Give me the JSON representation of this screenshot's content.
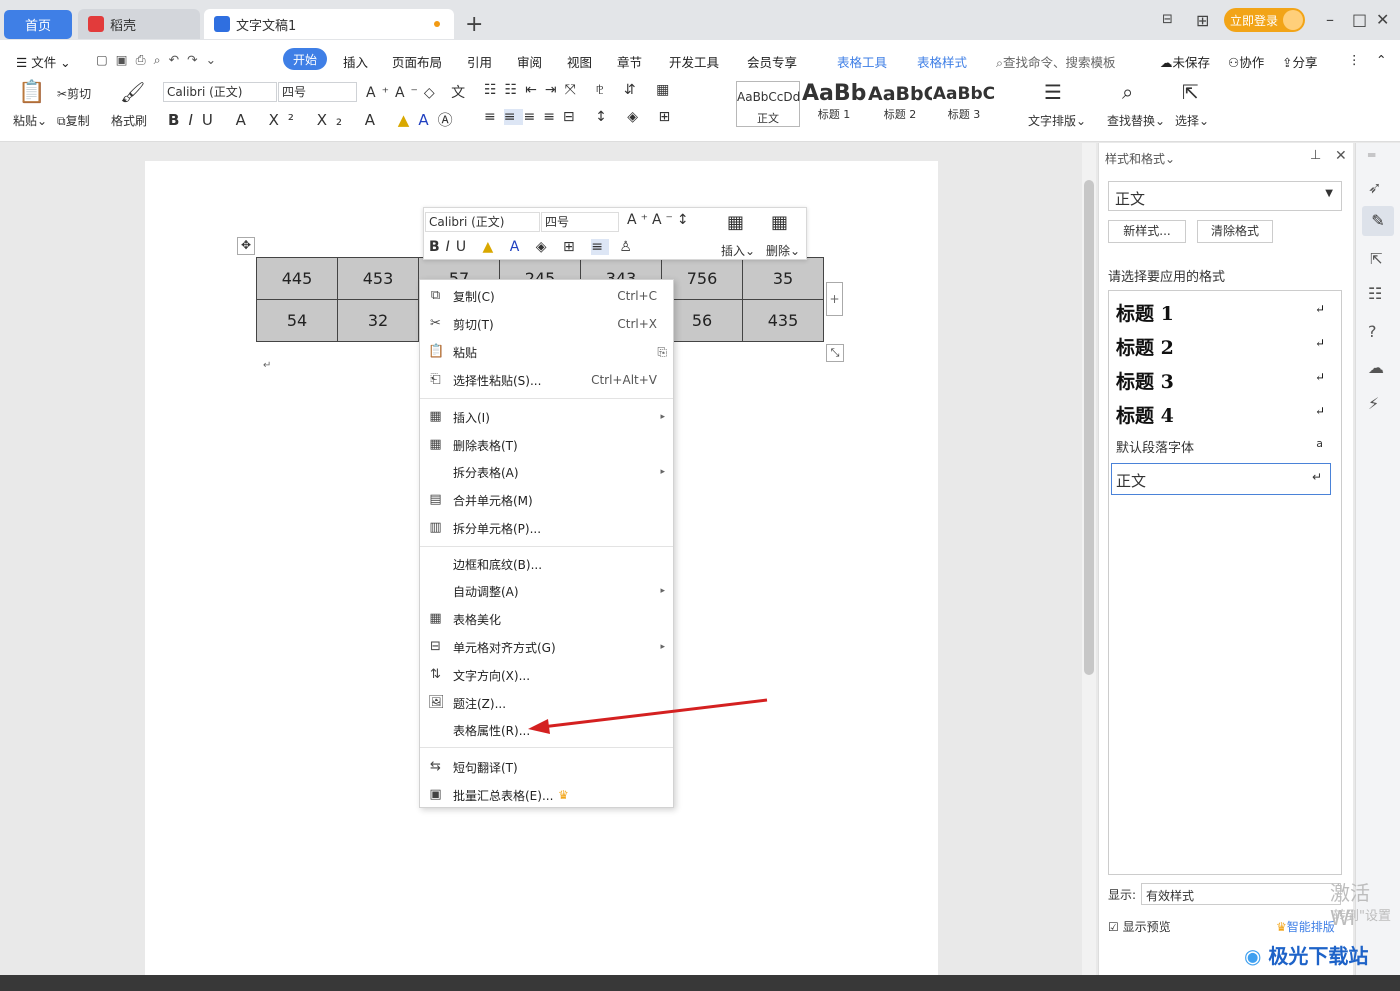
{
  "tabs": {
    "home": "首页",
    "daoke": "稻壳",
    "doc": "文字文稿1"
  },
  "login": "立即登录",
  "menu": {
    "file": "文件",
    "start": "开始",
    "insert": "插入",
    "layout": "页面布局",
    "ref": "引用",
    "review": "审阅",
    "view": "视图",
    "chapter": "章节",
    "dev": "开发工具",
    "member": "会员专享",
    "table_tools": "表格工具",
    "table_style": "表格样式",
    "search": "查找命令、搜索模板",
    "unsaved": "未保存",
    "collab": "协作",
    "share": "分享"
  },
  "ribbon": {
    "paste": "粘贴",
    "cut": "剪切",
    "copy": "复制",
    "format_painter": "格式刷",
    "font": "Calibri (正文)",
    "size": "四号",
    "styles": [
      {
        "preview": "AaBbCcDd",
        "name": "正文"
      },
      {
        "preview": "AaBb",
        "name": "标题 1"
      },
      {
        "preview": "AaBbC",
        "name": "标题 2"
      },
      {
        "preview": "AaBbC",
        "name": "标题 3"
      }
    ],
    "text_layout": "文字排版",
    "find_replace": "查找替换",
    "select": "选择"
  },
  "table": {
    "rows": [
      [
        "445",
        "453",
        "57",
        "245",
        "343",
        "756",
        "35"
      ],
      [
        "54",
        "32",
        "",
        "",
        "",
        "56",
        "435"
      ]
    ]
  },
  "float_toolbar": {
    "font": "Calibri (正文)",
    "size": "四号",
    "insert": "插入",
    "delete": "删除"
  },
  "context_menu": {
    "copy": "复制(C)",
    "copy_sc": "Ctrl+C",
    "cut": "剪切(T)",
    "cut_sc": "Ctrl+X",
    "paste": "粘贴",
    "paste_special": "选择性粘贴(S)...",
    "paste_special_sc": "Ctrl+Alt+V",
    "insert": "插入(I)",
    "delete_table": "删除表格(T)",
    "split_table": "拆分表格(A)",
    "merge_cells": "合并单元格(M)",
    "split_cells": "拆分单元格(P)...",
    "borders": "边框和底纹(B)...",
    "autofit": "自动调整(A)",
    "beautify": "表格美化",
    "cell_align": "单元格对齐方式(G)",
    "text_dir": "文字方向(X)...",
    "caption": "题注(Z)...",
    "table_props": "表格属性(R)...",
    "translate": "短句翻译(T)",
    "batch": "批量汇总表格(E)..."
  },
  "panel": {
    "title": "样式和格式",
    "current": "正文",
    "new_style": "新样式...",
    "clear": "清除格式",
    "prompt": "请选择要应用的格式",
    "items": [
      "标题  1",
      "标题  2",
      "标题  3",
      "标题  4"
    ],
    "default_font": "默认段落字体",
    "body": "正文",
    "show_label": "显示:",
    "show_value": "有效样式",
    "preview": "显示预览",
    "smart": "智能排版"
  },
  "watermark": {
    "activate": "激活 Wi",
    "goto": "转到\"设置"
  },
  "logo": "极光下载站"
}
